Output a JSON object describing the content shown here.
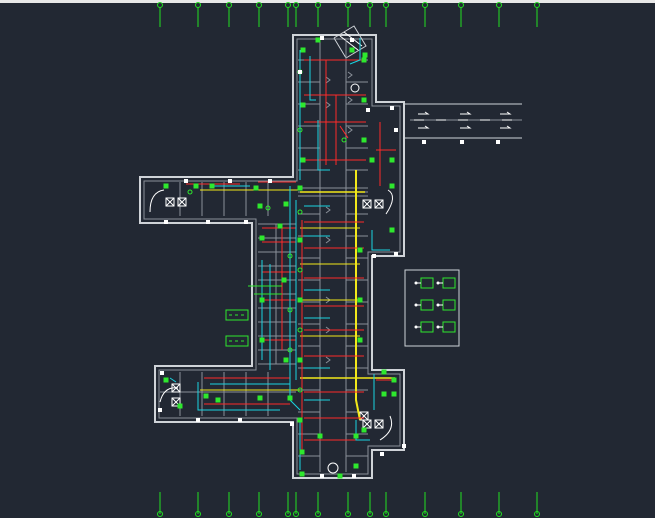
{
  "app": {
    "view": "model-space",
    "background": "#222833"
  },
  "colors": {
    "wall": "#cfd3d8",
    "wall_dim": "#8a9099",
    "grid_axis": "#21e021",
    "hot_water": "#ff2a2a",
    "cold_water": "#19d3e0",
    "main_pipe": "#f2e81a",
    "device": "#2ee82e",
    "white": "#ffffff"
  },
  "grid_axes": {
    "count_top": 15,
    "count_bottom": 15,
    "bubble": "circle"
  },
  "legend": {
    "title": "",
    "symbol_count": 6,
    "symbol_icon": "equipment-symbol"
  },
  "notes": {
    "tag_blocks": 2
  }
}
